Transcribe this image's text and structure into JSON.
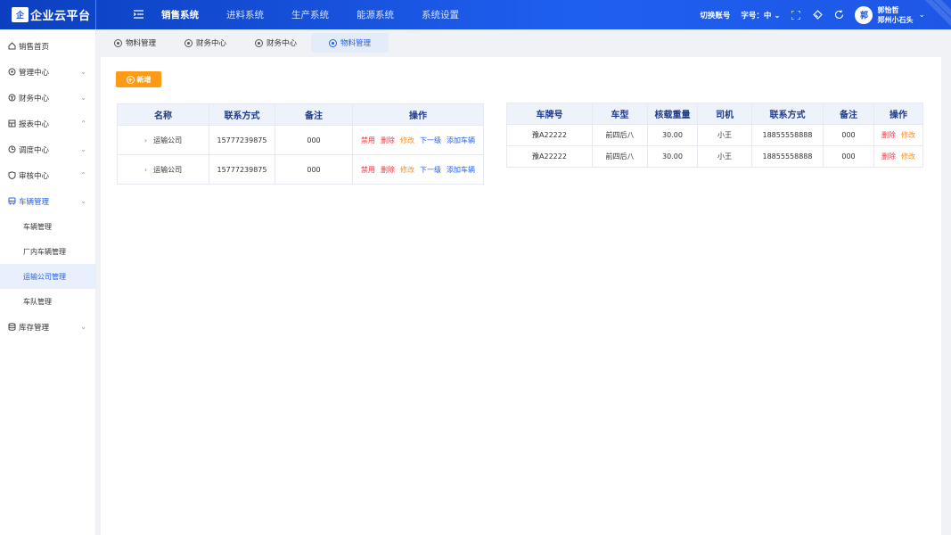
{
  "brand": {
    "logo_text": "企",
    "name": "企业云平台"
  },
  "header": {
    "nav": [
      "销售系统",
      "进料系统",
      "生产系统",
      "能源系统",
      "系统设置"
    ],
    "switch_account": "切换账号",
    "font_size_label": "字号：中",
    "user": {
      "avatar_text": "郭",
      "name": "郭怡哲",
      "company": "郑州小石头"
    }
  },
  "sidebar": {
    "items": [
      {
        "label": "销售首页",
        "icon": "home-icon",
        "chevron": ""
      },
      {
        "label": "管理中心",
        "icon": "gear-icon",
        "chevron": "⌄"
      },
      {
        "label": "财务中心",
        "icon": "finance-icon",
        "chevron": "⌄"
      },
      {
        "label": "报表中心",
        "icon": "report-icon",
        "chevron": "⌃"
      },
      {
        "label": "调度中心",
        "icon": "dispatch-icon",
        "chevron": "⌄"
      },
      {
        "label": "审核中心",
        "icon": "shield-icon",
        "chevron": "⌃"
      },
      {
        "label": "车辆管理",
        "icon": "bus-icon",
        "chevron": "⌄"
      }
    ],
    "sub_items": [
      "车辆管理",
      "厂内车辆管理",
      "运输公司管理",
      "车队管理"
    ],
    "last_item": {
      "label": "库存管理",
      "icon": "database-icon",
      "chevron": "⌄"
    }
  },
  "tabs": [
    "物料管理",
    "财务中心",
    "财务中心",
    "物料管理"
  ],
  "actions": {
    "add_label": "新增"
  },
  "company_table": {
    "headers": [
      "名称",
      "联系方式",
      "备注",
      "操作"
    ],
    "rows": [
      {
        "name": "运输公司",
        "phone": "15777239875",
        "remark": "000"
      },
      {
        "name": "运输公司",
        "phone": "15777239875",
        "remark": "000"
      }
    ],
    "row_actions": [
      "禁用",
      "删除",
      "修改",
      "下一级",
      "添加车辆"
    ]
  },
  "vehicle_table": {
    "headers": [
      "车牌号",
      "车型",
      "核载重量",
      "司机",
      "联系方式",
      "备注",
      "操作"
    ],
    "rows": [
      {
        "plate": "豫A22222",
        "type": "前四后八",
        "load": "30.00",
        "driver": "小王",
        "phone": "18855558888",
        "remark": "000"
      },
      {
        "plate": "豫A22222",
        "type": "前四后八",
        "load": "30.00",
        "driver": "小王",
        "phone": "18855558888",
        "remark": "000"
      }
    ],
    "row_actions": [
      "删除",
      "修改"
    ]
  }
}
